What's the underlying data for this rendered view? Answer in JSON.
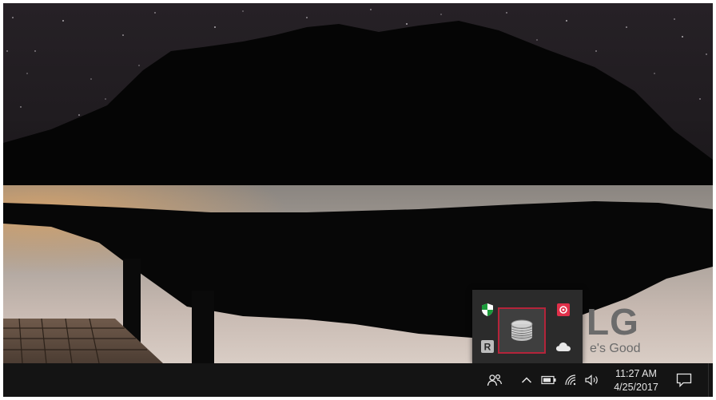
{
  "desktop": {
    "brand": {
      "logo": "LG",
      "tagline": "e's Good"
    }
  },
  "tray_overflow": {
    "icons": [
      "windows-defender-shield-icon",
      "red-app-icon",
      "r-app-icon",
      "onedrive-cloud-icon"
    ],
    "selected_icon": "coil-app-icon",
    "r_icon_label": "R",
    "highlight_color": "#b4243a"
  },
  "taskbar": {
    "time": "11:27 AM",
    "date": "4/25/2017",
    "icons": [
      "people-icon",
      "chevron-up-icon",
      "battery-icon",
      "wifi-icon",
      "volume-icon",
      "action-center-icon"
    ]
  }
}
